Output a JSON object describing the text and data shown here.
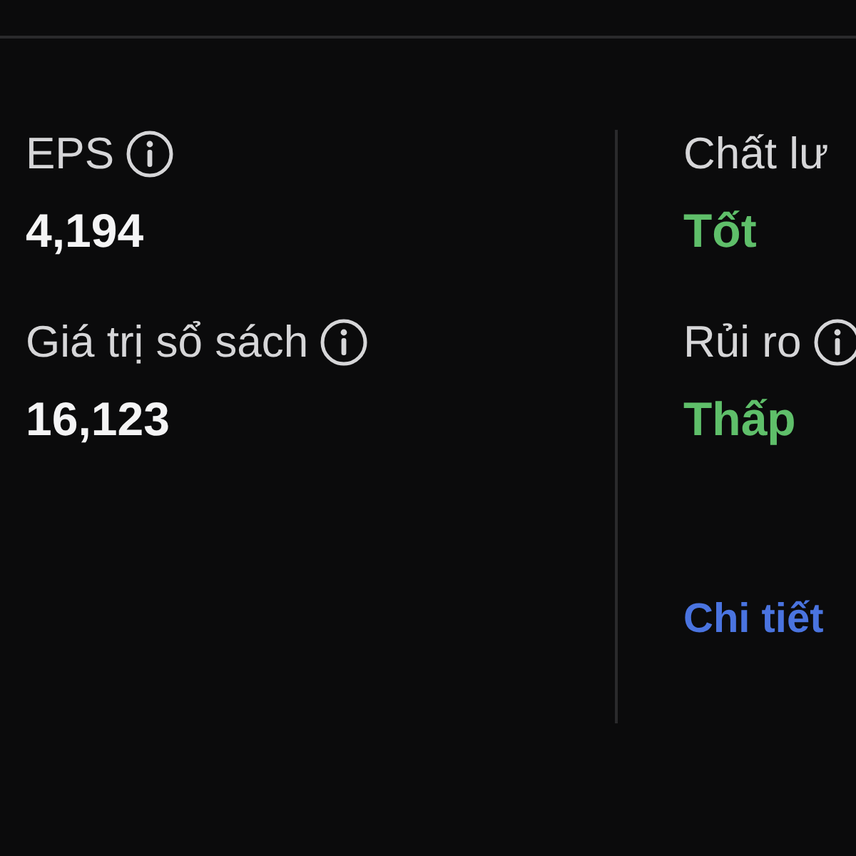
{
  "left_metrics": [
    {
      "label": "EPS",
      "info": true,
      "value": "4,194"
    },
    {
      "label": "Giá trị sổ sách",
      "info": true,
      "value": "16,123"
    }
  ],
  "right_metrics": [
    {
      "label": "Chất lư",
      "info": false,
      "value": "Tốt",
      "color": "#5fbf6a"
    },
    {
      "label": "Rủi ro",
      "info": true,
      "value": "Thấp",
      "color": "#5fbf6a"
    }
  ],
  "details_link": "Chi tiết"
}
